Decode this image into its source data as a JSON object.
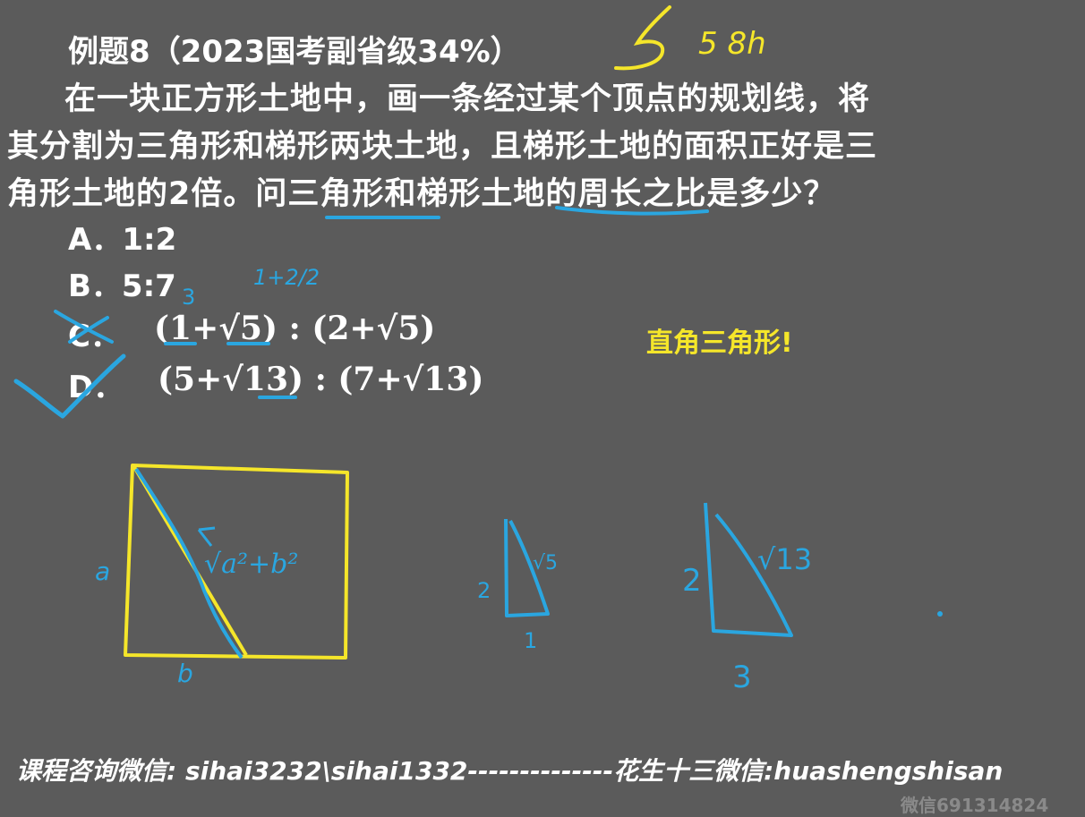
{
  "question": {
    "title": "例题8（2023国考副省级34%）",
    "line1": "在一块正方形土地中，画一条经过某个顶点的规划线，将",
    "line2": "其分割为三角形和梯形两块土地，且梯形土地的面积正好是三",
    "line3": "角形土地的2倍。问三角形和梯形土地的周长之比是多少？"
  },
  "options": [
    {
      "label": "A．1:2",
      "math": ""
    },
    {
      "label": "B．5:7",
      "math": ""
    },
    {
      "label": "C．",
      "math": "(1+√5)  :   (2+√5)"
    },
    {
      "label": "D．",
      "math": "(5+√13)  :   (7+√13)"
    }
  ],
  "note": "直角三角形!",
  "footer": "课程咨询微信: sihai3232\\sihai1332--------------花生十三微信:huashengshisan",
  "watermark": "微信691314824",
  "handwriting": {
    "top_marks": "5  8h",
    "b_frac": "1+2/2",
    "c_mark": "3",
    "diag_label": "√a²+b²",
    "side_a": "a",
    "side_b": "b",
    "tri1_side": "2",
    "tri1_base": "1",
    "tri1_hyp": "√5",
    "tri2_side": "2",
    "tri2_base": "3",
    "tri2_hyp": "√13"
  },
  "colors": {
    "background": "#5b5b5b",
    "text": "#ffffff",
    "yellow": "#f5e62a",
    "blue": "#2aa6e0"
  }
}
